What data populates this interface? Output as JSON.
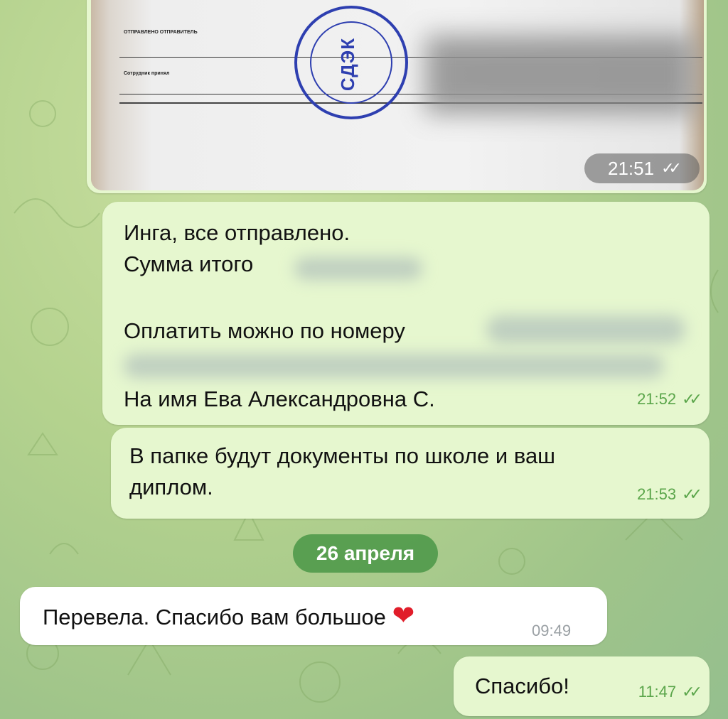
{
  "photo_message": {
    "time": "21:51",
    "stamp_logo": "СДЭК",
    "form_labels": [
      "ОТПРАВЛЕНО ОТПРАВИТЕЛЬ",
      "Сотрудник принял"
    ]
  },
  "messages": [
    {
      "lines": [
        "Инга, все отправлено.",
        "Сумма итого",
        "",
        "Оплатить можно по номеру",
        "",
        "На имя Ева Александровна С."
      ],
      "time": "21:52"
    },
    {
      "lines": [
        "В папке будут документы по школе и ваш",
        "диплом."
      ],
      "time": "21:53"
    }
  ],
  "date_separator": "26 апреля",
  "incoming": {
    "text": "Перевела. Спасибо вам большое",
    "emoji": "❤",
    "time": "09:49"
  },
  "reply": {
    "text": "Спасибо!",
    "time": "11:47"
  },
  "colors": {
    "outgoing_bubble": "#e6f7cf",
    "incoming_bubble": "#ffffff",
    "time_green": "#5aa54a",
    "date_pill": "#4a9646"
  },
  "icons": {
    "read_receipt": "double-check-icon",
    "heart": "red-heart-icon"
  }
}
